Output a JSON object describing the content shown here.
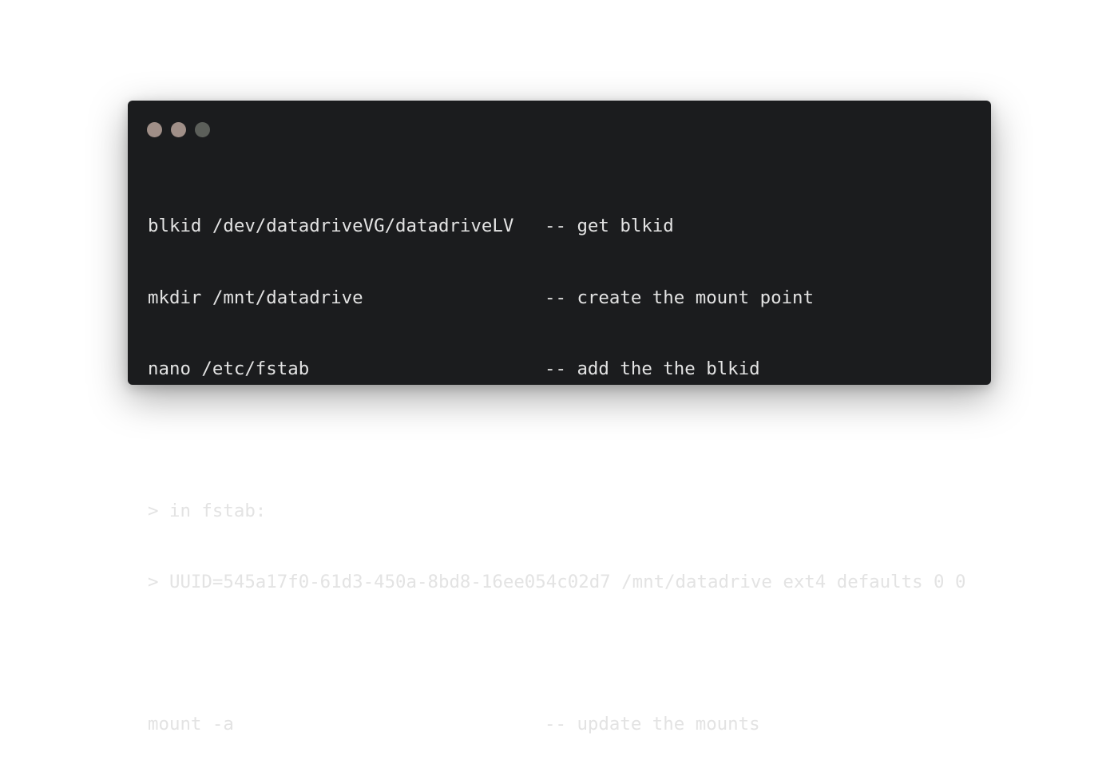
{
  "window_controls": {
    "close_color": "#a08f88",
    "minimize_color": "#a08f88",
    "maximize_color": "#5c5f5a"
  },
  "lines": [
    {
      "command": "blkid /dev/datadriveVG/datadriveLV",
      "comment": "-- get blkid"
    },
    {
      "command": "mkdir /mnt/datadrive",
      "comment": "-- create the mount point"
    },
    {
      "command": "nano /etc/fstab",
      "comment": "-- add the the blkid"
    },
    {
      "command": "",
      "comment": ""
    },
    {
      "command": "> in fstab:",
      "comment": ""
    },
    {
      "command": "> UUID=545a17f0-61d3-450a-8bd8-16ee054c02d7 /mnt/datadrive ext4 defaults 0 0",
      "comment": ""
    },
    {
      "command": "",
      "comment": ""
    },
    {
      "command": "mount -a",
      "comment": "-- update the mounts"
    }
  ]
}
